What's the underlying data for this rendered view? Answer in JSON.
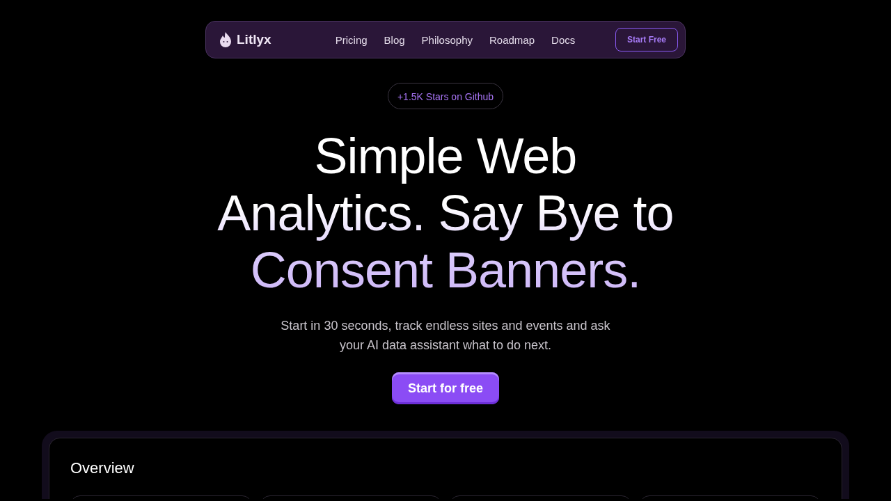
{
  "nav": {
    "logo": "Litlyx",
    "links": [
      "Pricing",
      "Blog",
      "Philosophy",
      "Roadmap",
      "Docs"
    ],
    "cta": "Start Free"
  },
  "badge": "+1.5K Stars on Github",
  "hero": {
    "title": "Simple Web Analytics. Say Bye to Consent Banners.",
    "subtitle": "Start in 30 seconds, track endless sites and events and ask your AI data assistant what to do next.",
    "cta": "Start for free"
  },
  "preview": {
    "title": "Overview"
  }
}
